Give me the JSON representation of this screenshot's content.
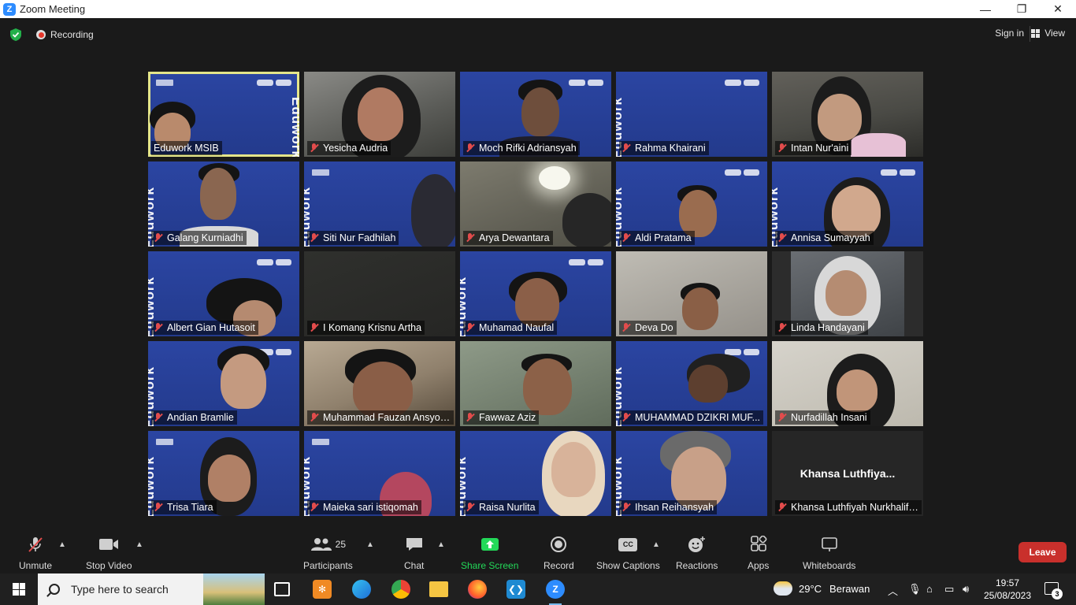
{
  "window": {
    "title": "Zoom Meeting",
    "minimize": "—",
    "restore": "❐",
    "close": "✕"
  },
  "topbar": {
    "recording_label": "Recording",
    "signin_label": "Sign in",
    "view_label": "View"
  },
  "participants_tiles": [
    {
      "name": "Eduwork MSIB",
      "muted": false,
      "active_speaker": true
    },
    {
      "name": "Yesicha Audria",
      "muted": true
    },
    {
      "name": "Moch Rifki Adriansyah",
      "muted": true
    },
    {
      "name": "Rahma Khairani",
      "muted": true
    },
    {
      "name": "Intan Nur'aini",
      "muted": true
    },
    {
      "name": "Galang Kurniadhi",
      "muted": true
    },
    {
      "name": "Siti Nur Fadhilah",
      "muted": true
    },
    {
      "name": "Arya Dewantara",
      "muted": true
    },
    {
      "name": "Aldi Pratama",
      "muted": true
    },
    {
      "name": "Annisa Sumayyah",
      "muted": true
    },
    {
      "name": "Albert Gian Hutasoit",
      "muted": true
    },
    {
      "name": "I Komang Krisnu Artha",
      "muted": true
    },
    {
      "name": "Muhamad Naufal",
      "muted": true
    },
    {
      "name": "Deva Do",
      "muted": true
    },
    {
      "name": "Linda Handayani",
      "muted": true
    },
    {
      "name": "Andian Bramlie",
      "muted": true
    },
    {
      "name": "Muhammad Fauzan Ansyor...",
      "muted": true
    },
    {
      "name": "Fawwaz Aziz",
      "muted": true
    },
    {
      "name": "MUHAMMAD DZIKRI MUF...",
      "muted": true
    },
    {
      "name": "Nurfadillah Insani",
      "muted": true
    },
    {
      "name": "Trisa Tiara",
      "muted": true
    },
    {
      "name": "Maieka sari istiqomah",
      "muted": true
    },
    {
      "name": "Raisa Nurlita",
      "muted": true
    },
    {
      "name": "Ihsan Reihansyah",
      "muted": true
    },
    {
      "name": "Khansa Luthfiyah Nurkhalifah",
      "muted": true,
      "video_off_display": "Khansa  Luthfiya..."
    }
  ],
  "background_brand": "Eduwork",
  "toolbar": {
    "unmute": "Unmute",
    "stop_video": "Stop Video",
    "participants": "Participants",
    "participants_count": "25",
    "chat": "Chat",
    "share_screen": "Share Screen",
    "record": "Record",
    "show_captions": "Show Captions",
    "captions_icon": "CC",
    "reactions": "Reactions",
    "apps": "Apps",
    "whiteboards": "Whiteboards",
    "leave": "Leave"
  },
  "taskbar": {
    "search_placeholder": "Type here to search",
    "temperature": "29°C",
    "weather_text": "Berawan",
    "time": "19:57",
    "date": "25/08/2023",
    "notification_count": "3"
  },
  "colors": {
    "share_green": "#23d959",
    "leave_red": "#c9302c",
    "active_speaker_outline": "#e4e58a",
    "zoom_blue": "#2d8cff"
  }
}
